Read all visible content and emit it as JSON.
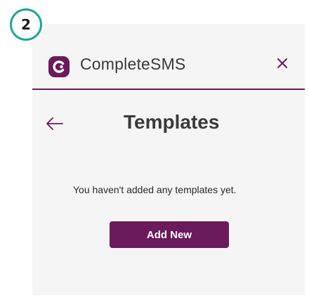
{
  "step_badge": {
    "number": "2",
    "color": "#1fa69a"
  },
  "header": {
    "brand_name": "CompleteSMS",
    "logo_icon": "completesms-logo-icon",
    "close_icon": "close-icon",
    "accent_color": "#6b1a5c"
  },
  "page": {
    "back_icon": "back-arrow-icon",
    "title": "Templates",
    "empty_message": "You haven't added any templates yet.",
    "add_new_label": "Add New"
  },
  "colors": {
    "primary": "#6b1a5c",
    "panel_background": "#f5f5f5",
    "text": "#3a3a3a"
  }
}
